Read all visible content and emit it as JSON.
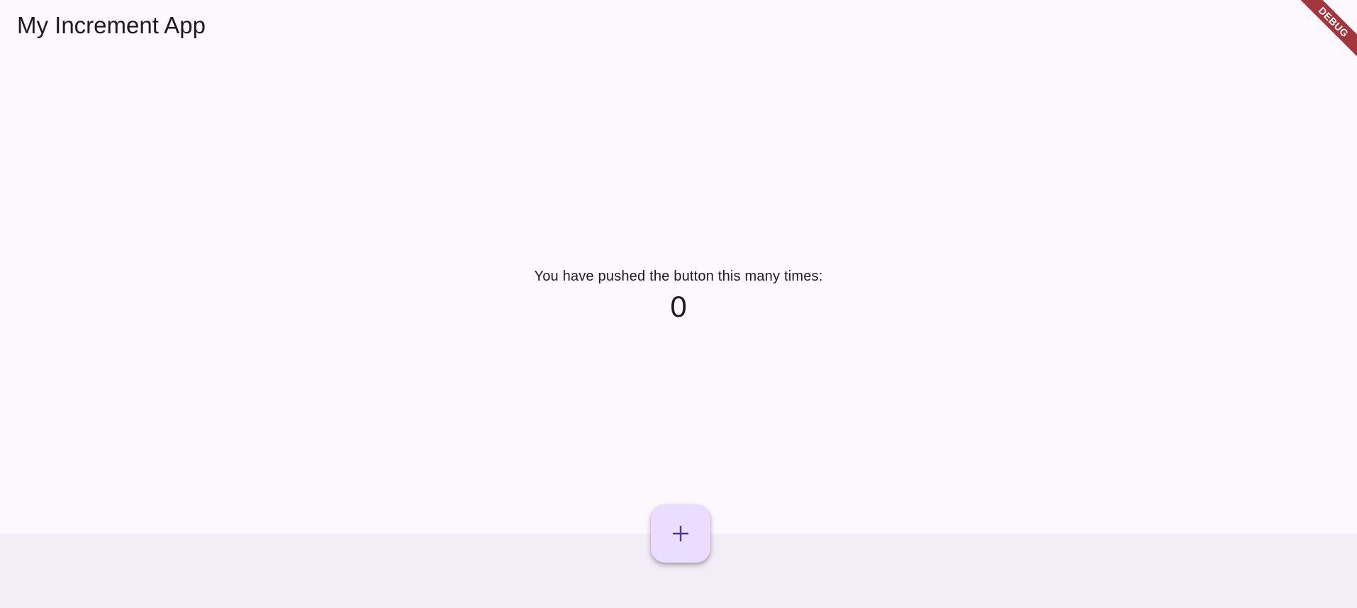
{
  "app_bar": {
    "title": "My Increment App"
  },
  "counter": {
    "caption": "You have pushed the button this many times:",
    "value": "0"
  },
  "fab": {
    "icon": "plus-icon",
    "color": "#eaddff",
    "icon_color": "#4f378b"
  },
  "debug_banner": {
    "label": "DEBUG",
    "color": "#a2363c"
  },
  "colors": {
    "background": "#fdf7fe",
    "bottom_bar": "#f3edf7",
    "text": "#1d1b20"
  }
}
